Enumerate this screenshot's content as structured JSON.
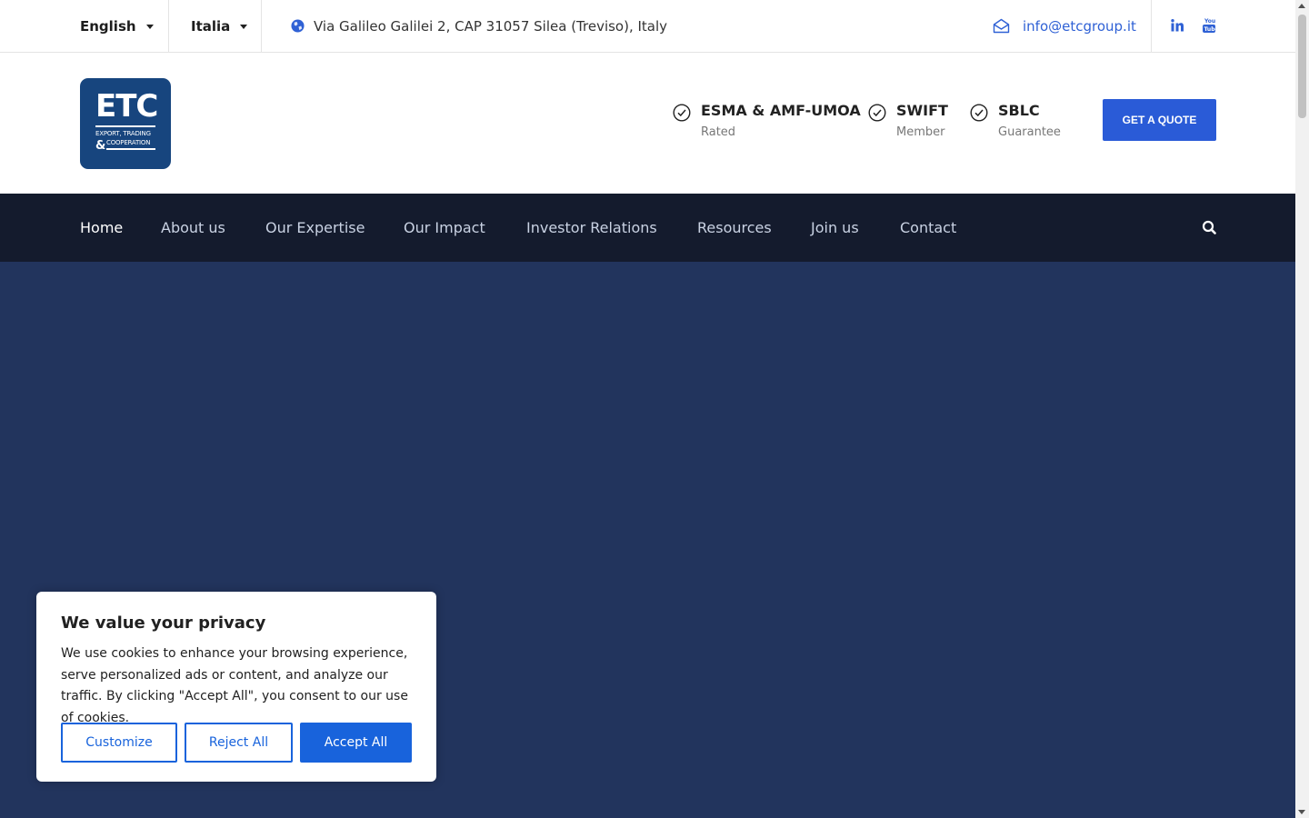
{
  "topbar": {
    "language": "English",
    "country": "Italia",
    "address": "Via Galileo Galilei 2, CAP 31057 Silea (Treviso), Italy",
    "email": "info@etcgroup.it",
    "social": [
      "linkedin-icon",
      "youtube-icon"
    ]
  },
  "logo": {
    "main": "ETC",
    "line1": "EXPORT, TRADING",
    "amp": "&",
    "line2": "COOPERATION"
  },
  "features": [
    {
      "title": "ESMA & AMF-UMOA",
      "subtitle": "Rated"
    },
    {
      "title": "SWIFT",
      "subtitle": "Member"
    },
    {
      "title": "SBLC",
      "subtitle": "Guarantee"
    }
  ],
  "cta": {
    "label": "GET A QUOTE"
  },
  "nav": {
    "items": [
      "Home",
      "About us",
      "Our Expertise",
      "Our Impact",
      "Investor Relations",
      "Resources",
      "Join us",
      "Contact"
    ],
    "active": "Home"
  },
  "cookie": {
    "title": "We value your privacy",
    "text": "We use cookies to enhance your browsing experience, serve personalized ads or content, and analyze our traffic. By clicking \"Accept All\", you consent to our use of cookies.",
    "customize": "Customize",
    "reject": "Reject All",
    "accept": "Accept All"
  },
  "colors": {
    "accent": "#2a5bd7",
    "nav_bg": "#141b2d",
    "hero_bg": "#22345d",
    "logo_bg": "#17457e"
  }
}
